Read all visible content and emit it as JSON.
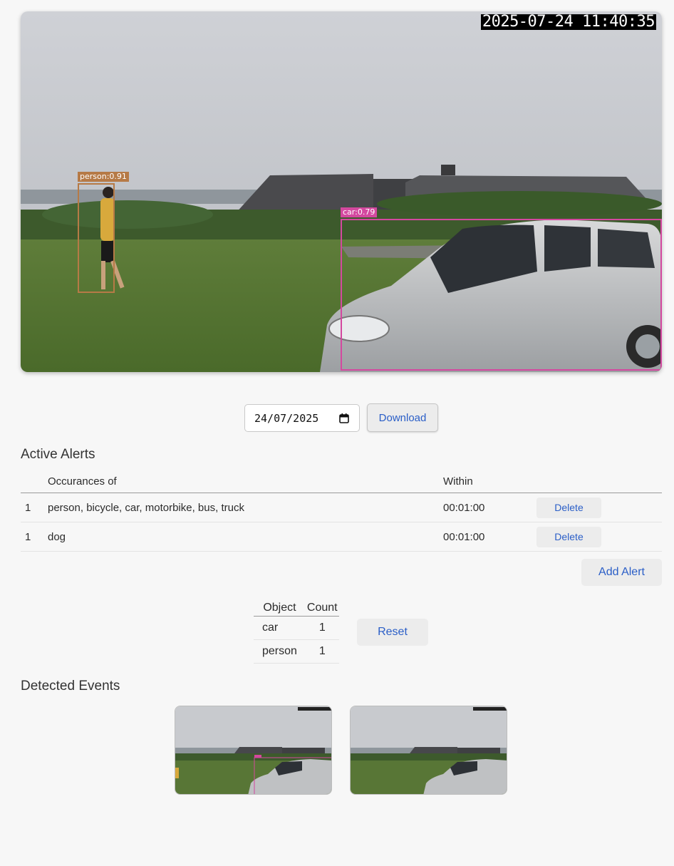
{
  "feed": {
    "timestamp": "2025-07-24 11:40:35",
    "detections": [
      {
        "label": "person:0.91",
        "color": "#b67a46"
      },
      {
        "label": "car:0.79",
        "color": "#d4489f"
      }
    ]
  },
  "controls": {
    "date_value": "24/07/2025",
    "download_label": "Download"
  },
  "alerts": {
    "title": "Active Alerts",
    "headers": [
      "",
      "Occurances of",
      "Within",
      ""
    ],
    "rows": [
      {
        "count": "1",
        "objects": "person, bicycle, car, motorbike, bus, truck",
        "within": "00:01:00",
        "action": "Delete"
      },
      {
        "count": "1",
        "objects": "dog",
        "within": "00:01:00",
        "action": "Delete"
      }
    ],
    "add_label": "Add Alert"
  },
  "counts": {
    "headers": [
      "Object",
      "Count"
    ],
    "rows": [
      {
        "object": "car",
        "count": "1"
      },
      {
        "object": "person",
        "count": "1"
      }
    ],
    "reset_label": "Reset"
  },
  "events": {
    "title": "Detected Events",
    "thumbnails": [
      {
        "name": "event-thumbnail-1"
      },
      {
        "name": "event-thumbnail-2"
      }
    ]
  },
  "colors": {
    "accent": "#2a5ec7",
    "background": "#f7f7f7"
  }
}
